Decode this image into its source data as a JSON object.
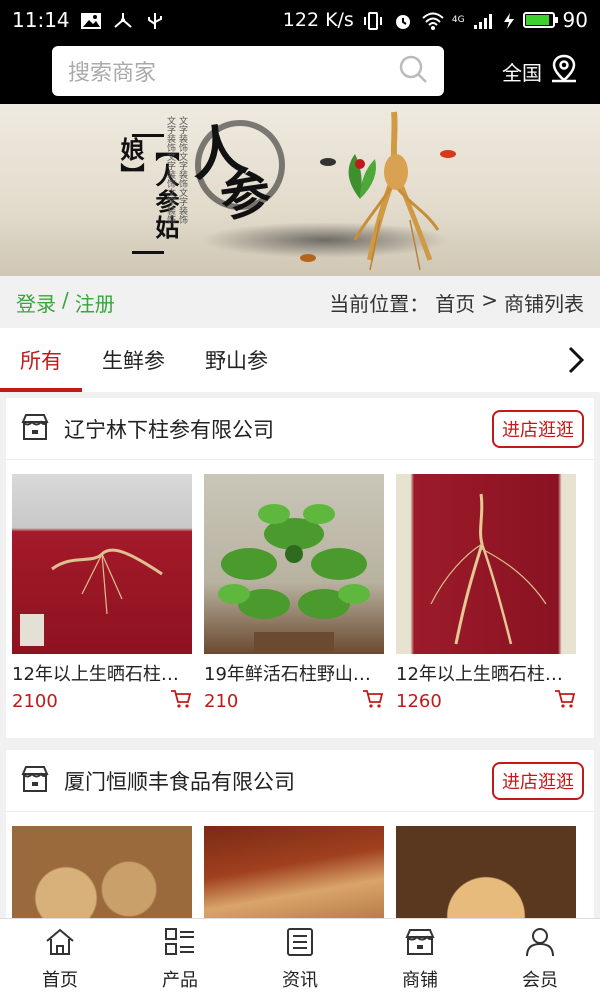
{
  "status_bar": {
    "time": "11:14",
    "network_speed": "122 K/s",
    "network_type": "4G",
    "battery_level": "90",
    "battery_fraction": 0.9,
    "icons": [
      "image-icon",
      "usb-share-icon",
      "usb-icon",
      "vibrate-icon",
      "alarm-icon",
      "wifi-icon",
      "signal-icon",
      "charging-icon",
      "battery-icon"
    ]
  },
  "header": {
    "search_placeholder": "搜索商家",
    "region_label": "全国"
  },
  "banner": {
    "title": "【人参姑娘】",
    "calligraphy_1": "人",
    "calligraphy_2": "参"
  },
  "breadcrumb": {
    "login": "登录",
    "separator": "/",
    "register": "注册",
    "current_prefix": "当前位置：",
    "home": "首页",
    "arrow": ">",
    "current": "商铺列表"
  },
  "tabs": [
    {
      "label": "所有",
      "active": true
    },
    {
      "label": "生鲜参",
      "active": false
    },
    {
      "label": "野山参",
      "active": false
    }
  ],
  "shops": [
    {
      "name": "辽宁林下柱参有限公司",
      "visit_label": "进店逛逛",
      "products": [
        {
          "name": "12年以上生晒石柱参...",
          "price": "2100"
        },
        {
          "name": "19年鲜活石柱野山参...",
          "price": "210"
        },
        {
          "name": "12年以上生晒石柱参...",
          "price": "1260"
        }
      ]
    },
    {
      "name": "厦门恒顺丰食品有限公司",
      "visit_label": "进店逛逛",
      "products": [
        {
          "name": "",
          "price": ""
        },
        {
          "name": "",
          "price": ""
        },
        {
          "name": "",
          "price": ""
        }
      ]
    }
  ],
  "bottom_nav": [
    {
      "label": "首页",
      "icon": "home-icon"
    },
    {
      "label": "产品",
      "icon": "list-icon"
    },
    {
      "label": "资讯",
      "icon": "news-icon"
    },
    {
      "label": "商铺",
      "icon": "store-icon"
    },
    {
      "label": "会员",
      "icon": "user-icon"
    }
  ],
  "colors": {
    "accent": "#c11a1a",
    "auth_green": "#3aa53a",
    "bar_black": "#000000"
  }
}
